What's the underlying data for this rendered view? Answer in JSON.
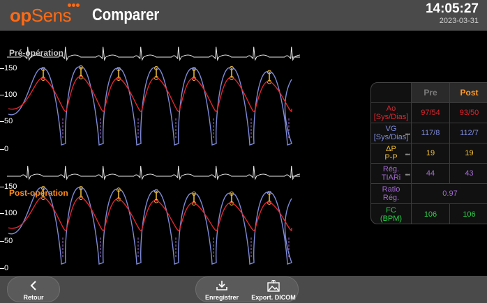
{
  "header": {
    "logo_op": "op",
    "logo_sens": "Sens",
    "title": "Comparer",
    "time": "14:05:27",
    "date": "2023-03-31"
  },
  "colors": {
    "brand_orange": "#ff6a13",
    "ao_red": "#e0262e",
    "vg_blue": "#7f8bd8",
    "dp_yellow": "#f2c23a",
    "reg_purple": "#a46bd1",
    "fc_green": "#2bd24a"
  },
  "sections": {
    "pre_title": "Pré-opération",
    "post_title": "Post-opération"
  },
  "ticks": {
    "pre": [
      "150",
      "100",
      "50",
      "0"
    ],
    "post": [
      "150",
      "100",
      "50",
      "0"
    ]
  },
  "table": {
    "header_pre": "Pre",
    "header_post": "Post",
    "rows": [
      {
        "label1": "Ao",
        "label2": "[Sys/Dias]",
        "pre": "97/54",
        "post": "93/50"
      },
      {
        "label1": "VG",
        "label2": "[Sys/Dias]",
        "pre": "117/8",
        "post": "112/7"
      },
      {
        "label1": "ΔP",
        "label2": "P-P",
        "pre": "19",
        "post": "19"
      },
      {
        "label1": "Rég.",
        "label2": "TIARi",
        "pre": "44",
        "post": "43"
      },
      {
        "label1": "Ratio",
        "label2": "Rég.",
        "value": "0.97"
      },
      {
        "label1": "FC",
        "label2": "(BPM)",
        "pre": "106",
        "post": "106"
      }
    ]
  },
  "footer": {
    "back_label": "Retour",
    "save_label": "Enregistrer",
    "export_label": "Export. DICOM"
  }
}
